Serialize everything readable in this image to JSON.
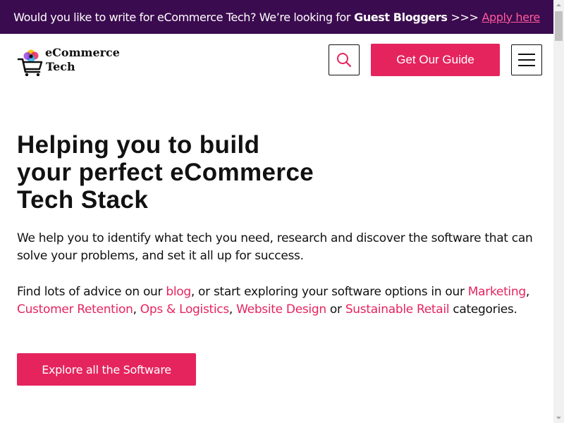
{
  "banner": {
    "text": "Would you like to write for eCommerce Tech? We’re looking for",
    "strong": "Guest Bloggers",
    "arrows": ">>>",
    "link": "Apply here"
  },
  "header": {
    "logo_line1": "eCommerce",
    "logo_line2": "Tech",
    "guide_button": "Get Our Guide"
  },
  "hero": {
    "title_lines": [
      "Helping you to build",
      "your perfect eCommerce",
      "Tech Stack"
    ],
    "paragraph1": "We help you to identify what tech you need, research and discover the software that can solve your problems, and set it all up for success.",
    "p2_a": "Find lots of advice on our ",
    "p2_blog": "blog",
    "p2_b": ", or start exploring your software options in our ",
    "p2_marketing": "Marketing",
    "p2_c": ", ",
    "p2_retention": "Customer Retention",
    "p2_d": ", ",
    "p2_ops": "Ops & Logistics",
    "p2_e": ", ",
    "p2_website": "Website Design",
    "p2_f": " or ",
    "p2_sustainable": "Sustainable Retail",
    "p2_g": " categories.",
    "explore_button": "Explore all the Software"
  },
  "colors": {
    "banner_bg": "#3b0b4f",
    "accent": "#e5245e",
    "banner_link": "#ff5b9a"
  },
  "icons": {
    "search": "search-icon",
    "menu": "hamburger-menu-icon",
    "logo": "shopping-cart-logo-icon"
  }
}
